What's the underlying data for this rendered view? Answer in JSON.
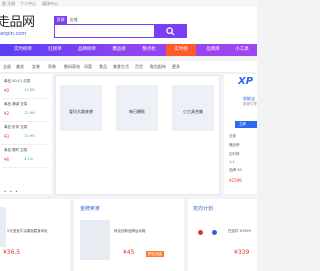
{
  "topbar": {
    "links": [
      "登 注册",
      "个人中心",
      "媒体中心"
    ]
  },
  "logo": {
    "main": "走品网",
    "sub": "anpin.com"
  },
  "search": {
    "tab_a": "资源",
    "tab_b": "店铺"
  },
  "nav": {
    "items": [
      "实时榜单",
      "红榜单",
      "品牌榜单",
      "爆品榜",
      "整点抢",
      "实时榜",
      "品牌库",
      "小工具"
    ]
  },
  "categories": [
    "全部",
    "美妆",
    "女装",
    "男装",
    "数码家电",
    "母婴",
    "食品",
    "美食生活",
    "百货",
    "鞋包配饰",
    "更多"
  ],
  "left_cards": [
    {
      "label": "单品 00:11 交易",
      "price": "¥0",
      "change": "11.8%"
    },
    {
      "label": "单品 满减 交易",
      "price": "¥2",
      "change": "12.9%"
    },
    {
      "label": "单品 折扣 交易",
      "price": "¥3",
      "change": "11.9%"
    },
    {
      "label": "单品 限时 交易",
      "price": "¥6",
      "change": "4.1%"
    }
  ],
  "banner": {
    "cards": [
      "爱玛大裁来袭",
      "每日爆款",
      "小工具合集"
    ]
  },
  "right_panel": {
    "logo": "XP",
    "line_blue": "效能宝",
    "line_grey": "数据引擎",
    "btn": "立即",
    "lines": [
      "全部",
      "爆品榜",
      "实时榜",
      "1:1",
      "品牌 38"
    ],
    "price": "¥2599"
  },
  "bottom": {
    "left": {
      "line1": "5天宝宝牛油果面霜身体乳",
      "price": "¥36.5"
    },
    "mid": {
      "title": "金牌卖家",
      "line1": "阿克西新品牌运动鞋",
      "price": "¥45",
      "badge": "预估佣金"
    },
    "right": {
      "title": "定向计划",
      "line1": "任选件 ¥3399",
      "price": "¥339"
    }
  }
}
